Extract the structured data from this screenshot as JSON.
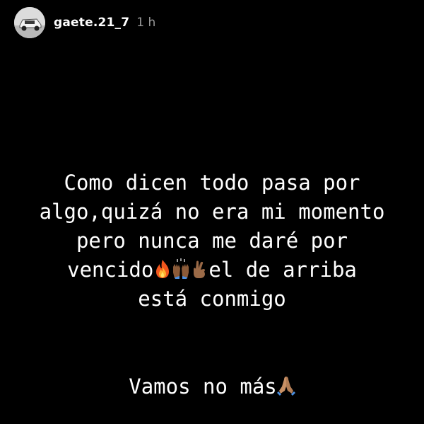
{
  "header": {
    "username": "gaete.21_7",
    "time": "1 h"
  },
  "story": {
    "line1": "Como dicen todo pasa por",
    "line2": "algo,quizá no era mi momento",
    "line3": "pero nunca me daré por",
    "line4_start": "vencido",
    "line4_end": "el de arriba",
    "line5": "está conmigo",
    "closing": "Vamos no más"
  },
  "emojis": [
    "fire-emoji",
    "raised-hands-emoji",
    "crossed-fingers-emoji",
    "folded-hands-emoji"
  ],
  "colors": {
    "background": "#000000",
    "text": "#ffffff",
    "time": "#9a9a9a"
  }
}
